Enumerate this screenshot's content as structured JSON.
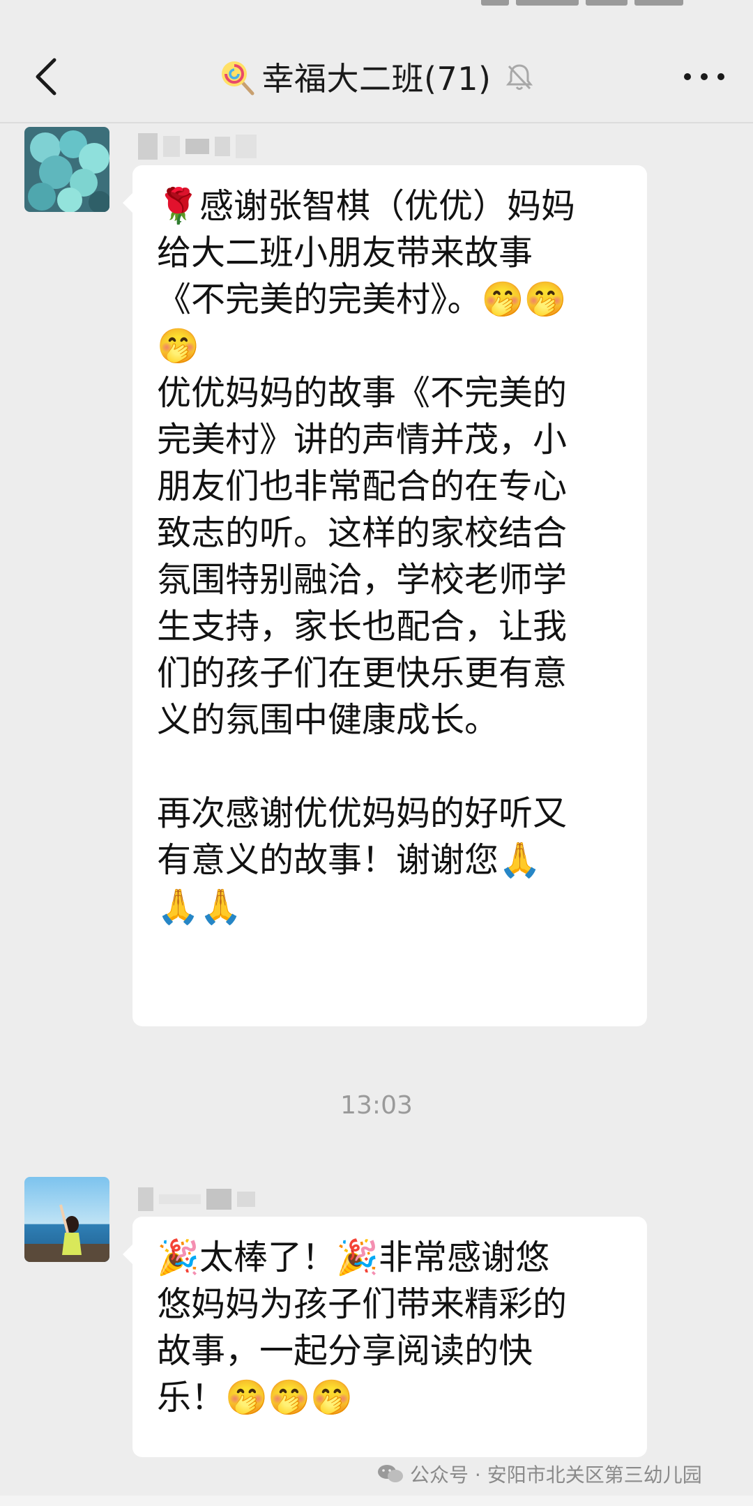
{
  "header": {
    "title": "幸福大二班(71)",
    "title_icon": "lollipop-icon",
    "mute_icon": "bell-off-icon",
    "back_icon": "chevron-left-icon",
    "more_icon": "more-dots-icon"
  },
  "messages": [
    {
      "avatar": "flower-bouquet-avatar",
      "lines": [
        "🌹感谢张智棋（优优）妈妈",
        "给大二班小朋友带来故事",
        "《不完美的完美村》。🤭🤭",
        "🤭",
        "优优妈妈的故事《不完美的",
        "完美村》讲的声情并茂，小",
        "朋友们也非常配合的在专心",
        "致志的听。这样的家校结合",
        "氛围特别融洽，学校老师学",
        "生支持，家长也配合，让我",
        "们的孩子们在更快乐更有意",
        "义的氛围中健康成长。",
        "",
        "再次感谢优优妈妈的好听又",
        "有意义的故事！谢谢您🙏",
        "🙏🙏"
      ]
    },
    {
      "avatar": "girl-by-sea-avatar",
      "lines": [
        "🎉太棒了！🎉非常感谢悠",
        "悠妈妈为孩子们带来精彩的",
        "故事，一起分享阅读的快",
        "乐！🤭🤭🤭"
      ]
    }
  ],
  "timestamp": "13:03",
  "watermark": "公众号 · 安阳市北关区第三幼儿园",
  "colors": {
    "background": "#ededed",
    "bubble": "#ffffff",
    "text": "#121212",
    "timestamp": "#9a9a9a"
  }
}
